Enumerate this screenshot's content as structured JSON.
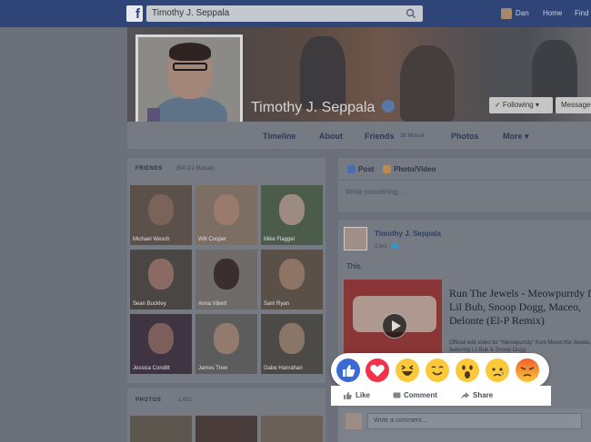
{
  "topbar": {
    "logo": "f",
    "search_value": "Timothy J. Seppala",
    "user_name": "Dan",
    "home_label": "Home",
    "find_label": "Find"
  },
  "profile": {
    "name": "Timothy J. Seppala",
    "following_label": "✓ Following ▾",
    "message_label": "Message"
  },
  "tabs": [
    {
      "label": "Timeline"
    },
    {
      "label": "About"
    },
    {
      "label": "Friends"
    },
    {
      "label": "Photos"
    },
    {
      "label": "More ▾"
    }
  ],
  "friends_count": "38 Mutual",
  "friends": {
    "title": "FRIENDS",
    "subtitle": "· 354 (21 Mutual)",
    "items": [
      {
        "name": "Michael Wesch"
      },
      {
        "name": "Will Cooper"
      },
      {
        "name": "Mike Flaggel"
      },
      {
        "name": "Sean Buckley"
      },
      {
        "name": "Anna Vibert"
      },
      {
        "name": "Sam Ryan"
      },
      {
        "name": "Jessica Conditt"
      },
      {
        "name": "James Trew"
      },
      {
        "name": "Gabe Hanrahan"
      }
    ]
  },
  "photos": {
    "title": "PHOTOS",
    "subtitle": "· 1,421"
  },
  "composer": {
    "post_label": "Post",
    "photo_video_label": "Photo/Video",
    "placeholder": "Write something..."
  },
  "post": {
    "author": "Timothy J. Seppala",
    "time": "2 hrs · 🌐",
    "text": "This.",
    "link_title": "Run The Jewels - Meowpurrdy ft Lil Bub, Snoop Dogg, Maceo, Delonte (El-P Remix)",
    "link_desc": "Official edit video for \"Meowpurrdy\" from Meow the Jewels, featuring Lil Bub & Snoop Dogg.",
    "comment_placeholder": "Write a comment..."
  },
  "reactions": [
    {
      "name": "like-reaction-icon",
      "color": "#3b6ad6"
    },
    {
      "name": "love-reaction-icon",
      "color": "#f0334b"
    },
    {
      "name": "haha-reaction-icon",
      "color": "#fcc93a"
    },
    {
      "name": "yay-reaction-icon",
      "color": "#fcc93a"
    },
    {
      "name": "wow-reaction-icon",
      "color": "#fcc93a"
    },
    {
      "name": "sad-reaction-icon",
      "color": "#fcc93a"
    },
    {
      "name": "angry-reaction-icon",
      "color": "#f05d2b"
    }
  ],
  "actions": {
    "like": "Like",
    "comment": "Comment",
    "share": "Share"
  },
  "colors": {
    "brand": "#2f4577",
    "popup_bg": "#ffffff"
  }
}
